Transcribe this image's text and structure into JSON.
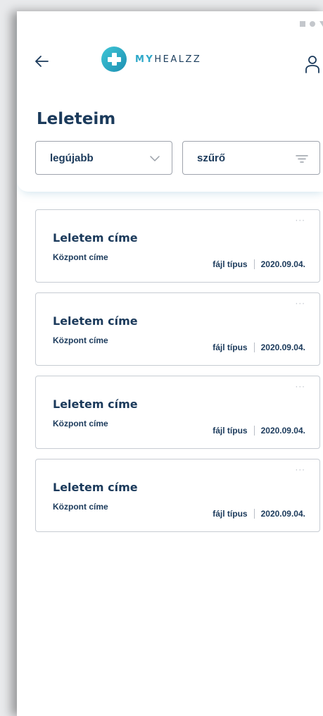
{
  "app": {
    "logo_prefix": "MY",
    "logo_suffix": "HEALZZ",
    "icons": {
      "back": "arrow-left-icon",
      "profile": "user-icon",
      "sort": "chevron-down-icon",
      "filter": "filter-lines-icon",
      "more": "more-dots-icon"
    },
    "colors": {
      "primary": "#1b3a5b",
      "accent": "#2ea8c9",
      "border": "#c7ccd3"
    }
  },
  "page": {
    "title": "Leleteim"
  },
  "controls": {
    "sort_value": "legújabb",
    "filter_label": "szűrő"
  },
  "results": [
    {
      "title": "Leletem címe",
      "center": "Központ címe",
      "file_type": "fájl típus",
      "date": "2020.09.04.",
      "more": "···"
    },
    {
      "title": "Leletem címe",
      "center": "Központ címe",
      "file_type": "fájl típus",
      "date": "2020.09.04.",
      "more": "···"
    },
    {
      "title": "Leletem címe",
      "center": "Központ címe",
      "file_type": "fájl típus",
      "date": "2020.09.04.",
      "more": "···"
    },
    {
      "title": "Leletem címe",
      "center": "Központ címe",
      "file_type": "fájl típus",
      "date": "2020.09.04.",
      "more": "···"
    }
  ]
}
